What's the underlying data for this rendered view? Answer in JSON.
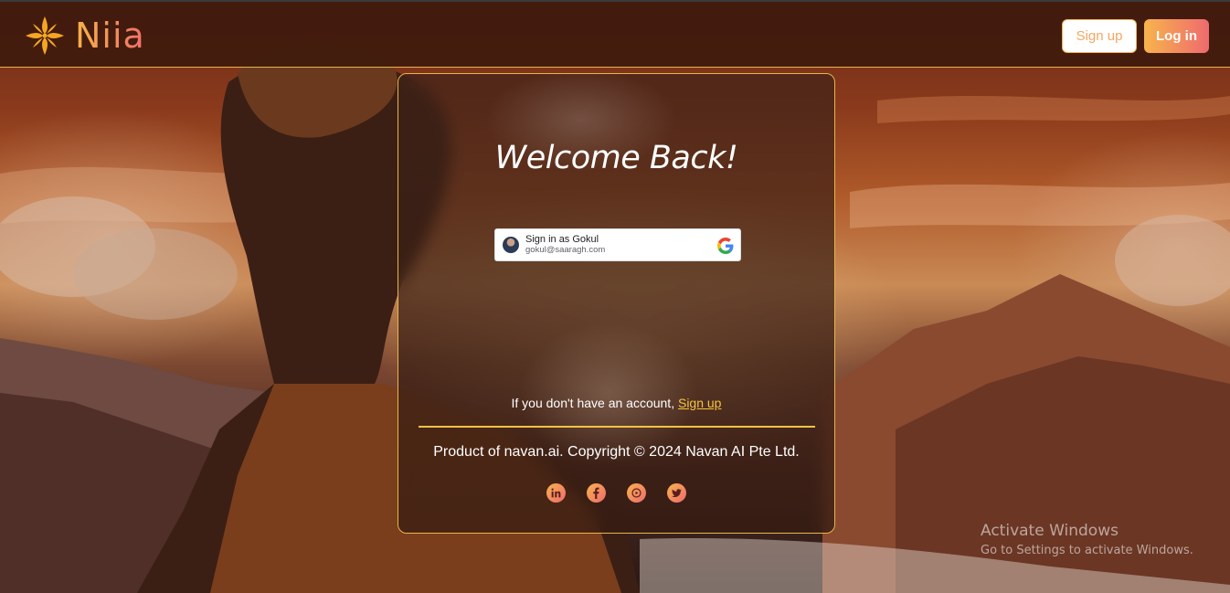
{
  "header": {
    "logo_text": "Niia",
    "signup_label": "Sign up",
    "login_label": "Log in"
  },
  "card": {
    "title": "Welcome Back!",
    "google": {
      "name_line": "Sign in as Gokul",
      "email": "gokul@saaragh.com"
    },
    "no_account_text": "If you don't have an account,",
    "signup_link": "Sign up",
    "copyright": "Product of navan.ai. Copyright © 2024 Navan AI Pte Ltd.",
    "socials": [
      "linkedin-icon",
      "facebook-icon",
      "youtube-icon",
      "twitter-icon"
    ]
  },
  "watermark": {
    "title": "Activate Windows",
    "subtitle": "Go to Settings to activate Windows."
  },
  "colors": {
    "accent_orange": "#f8b44c",
    "accent_pink": "#ee6a6e",
    "link_yellow": "#f5c342",
    "card_border": "#e9b64a"
  }
}
